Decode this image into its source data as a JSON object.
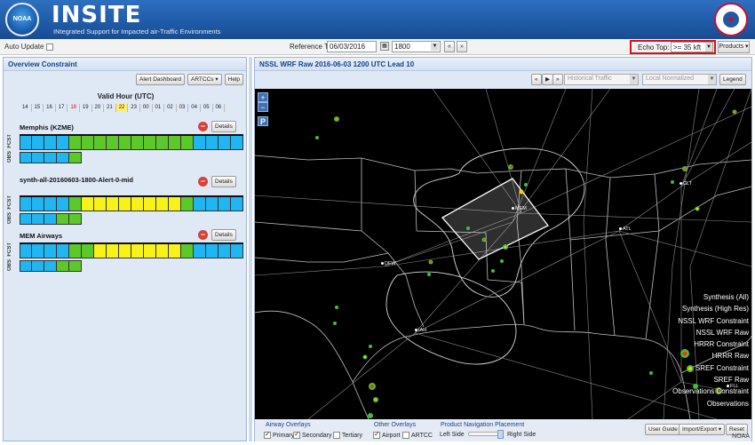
{
  "header": {
    "logo_text": "NOAA",
    "title": "INSITE",
    "subtitle": "INtegrated Support for Impacted air-Traffic Environments"
  },
  "toolbar": {
    "auto_update_label": "Auto Update",
    "reference_time_label": "Reference Time:",
    "date_value": "06/03/2016",
    "time_value": "1800",
    "echo_top_label": "Echo Top:",
    "echo_top_value": ">= 35 kft",
    "products_label": "Products"
  },
  "left_panel": {
    "title": "Overview Constraint",
    "buttons": {
      "alert_dashboard": "Alert Dashboard",
      "artccs": "ARTCCs",
      "help": "Help"
    },
    "valid_hour_title": "Valid Hour (UTC)",
    "hours": [
      "14",
      "15",
      "16",
      "17",
      "18",
      "19",
      "20",
      "21",
      "22",
      "23",
      "00",
      "01",
      "02",
      "03",
      "04",
      "05",
      "06"
    ],
    "current_hour": "18",
    "highlight_hour": "22",
    "details_label": "Details",
    "fcst_label": "FCST",
    "obs_label": "OBS",
    "constraints": [
      {
        "name": "Memphis (KZME)",
        "fcst": [
          "blue",
          "blue",
          "blue",
          "blue",
          "green",
          "green",
          "green",
          "green",
          "green",
          "green",
          "green",
          "green",
          "green",
          "green",
          "blue",
          "blue",
          "blue",
          "blue"
        ],
        "obs": [
          "blue",
          "blue",
          "blue",
          "blue",
          "green"
        ]
      },
      {
        "name": "synth-all-20160603-1800-Alert-0-mid",
        "fcst": [
          "blue",
          "blue",
          "blue",
          "blue",
          "green",
          "yellow",
          "yellow",
          "yellow",
          "yellow",
          "yellow",
          "yellow",
          "yellow",
          "yellow",
          "green",
          "blue",
          "blue",
          "blue",
          "blue"
        ],
        "obs": [
          "blue",
          "blue",
          "blue",
          "green",
          "green"
        ]
      },
      {
        "name": "MEM Airways",
        "fcst": [
          "blue",
          "blue",
          "blue",
          "blue",
          "green",
          "green",
          "yellow",
          "yellow",
          "yellow",
          "yellow",
          "yellow",
          "yellow",
          "yellow",
          "green",
          "blue",
          "blue",
          "blue",
          "blue"
        ],
        "obs": [
          "blue",
          "blue",
          "blue",
          "green",
          "green"
        ]
      }
    ]
  },
  "map_panel": {
    "title": "NSSL WRF Raw 2016-06-03 1200 UTC Lead 10",
    "historical_traffic": "Historical Traffic",
    "normalization": "Local Normalized",
    "legend_label": "Legend",
    "zoom_in": "+",
    "zoom_out": "−",
    "pan_label": "P",
    "cities": {
      "mem": "MEM",
      "dfw": "DFW",
      "atl": "ATL",
      "iah": "IAH",
      "clt": "CLT",
      "fll": "FLL"
    },
    "layers": [
      "Synthesis (All)",
      "Synthesis (High Res)",
      "NSSL WRF Constraint",
      "NSSL WRF Raw",
      "HRRR Constraint",
      "HRRR Raw",
      "SREF Constraint",
      "SREF Raw",
      "Observations Constraint",
      "Observations"
    ]
  },
  "map_bottom": {
    "airway_overlays_label": "Airway Overlays",
    "primary": "Primary",
    "secondary": "Secondary",
    "tertiary": "Tertiary",
    "other_overlays_label": "Other Overlays",
    "airport": "Airport",
    "artcc": "ARTCC",
    "product_nav_label": "Product Navigation Placement",
    "left_side": "Left Side",
    "right_side": "Right Side",
    "user_guide": "User Guide",
    "import_export": "Import/Export",
    "reset": "Reset"
  },
  "footer": {
    "noaa": "NOAA"
  },
  "colors": {
    "blue": "#1fb6f2",
    "green": "#5cc82a",
    "yellow": "#f7f21a",
    "accent": "#1f5aa6",
    "echo_highlight": "#d1141a"
  }
}
